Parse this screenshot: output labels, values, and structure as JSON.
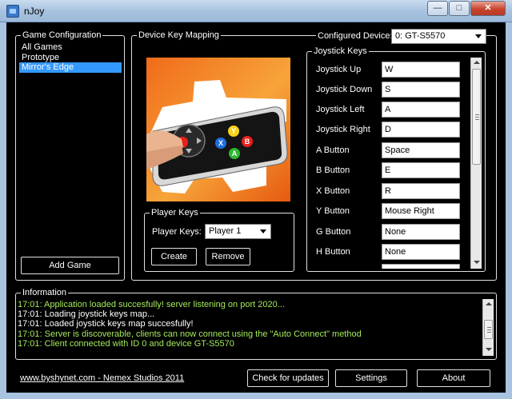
{
  "window": {
    "title": "nJoy",
    "min_glyph": "—",
    "max_glyph": "□",
    "close_glyph": "✕"
  },
  "game_config": {
    "title": "Game Configuration",
    "items": [
      "All Games",
      "Prototype",
      "Mirror's Edge"
    ],
    "selected_index": 2,
    "add_button": "Add Game"
  },
  "device_mapping": {
    "title": "Device Key Mapping",
    "configured_label": "Configured Device:",
    "configured_value": "0: GT-S5570",
    "face_buttons": [
      "Y",
      "X",
      "B",
      "A"
    ]
  },
  "player_keys": {
    "title": "Player Keys",
    "label": "Player Keys:",
    "value": "Player 1",
    "create_button": "Create",
    "remove_button": "Remove"
  },
  "joystick_keys": {
    "title": "Joystick Keys",
    "rows": [
      {
        "label": "Joystick Up",
        "value": "W"
      },
      {
        "label": "Joystick Down",
        "value": "S"
      },
      {
        "label": "Joystick Left",
        "value": "A"
      },
      {
        "label": "Joystick Right",
        "value": "D"
      },
      {
        "label": "A Button",
        "value": "Space"
      },
      {
        "label": "B Button",
        "value": "E"
      },
      {
        "label": "X Button",
        "value": "R"
      },
      {
        "label": "Y Button",
        "value": "Mouse Right"
      },
      {
        "label": "G Button",
        "value": "None"
      },
      {
        "label": "H Button",
        "value": "None"
      }
    ]
  },
  "information": {
    "title": "Information",
    "lines": [
      {
        "text": "17:01: Application loaded succesfully! server listening on port 2020...",
        "color": "green"
      },
      {
        "text": "17:01: Loading joystick keys map...",
        "color": "white"
      },
      {
        "text": "17:01: Loaded joystick keys map succesfully!",
        "color": "white"
      },
      {
        "text": "17:01: Server is discoverable, clients can now connect using the \"Auto Connect\" method",
        "color": "green"
      },
      {
        "text": "17:01: Client connected with ID 0 and device GT-S5570",
        "color": "green"
      }
    ]
  },
  "footer": {
    "link": "www.byshynet.com - Nemex Studios 2011",
    "check_updates": "Check for updates",
    "settings": "Settings",
    "about": "About"
  },
  "colors": {
    "selection": "#3399ff",
    "log_green": "#a4e85a"
  }
}
